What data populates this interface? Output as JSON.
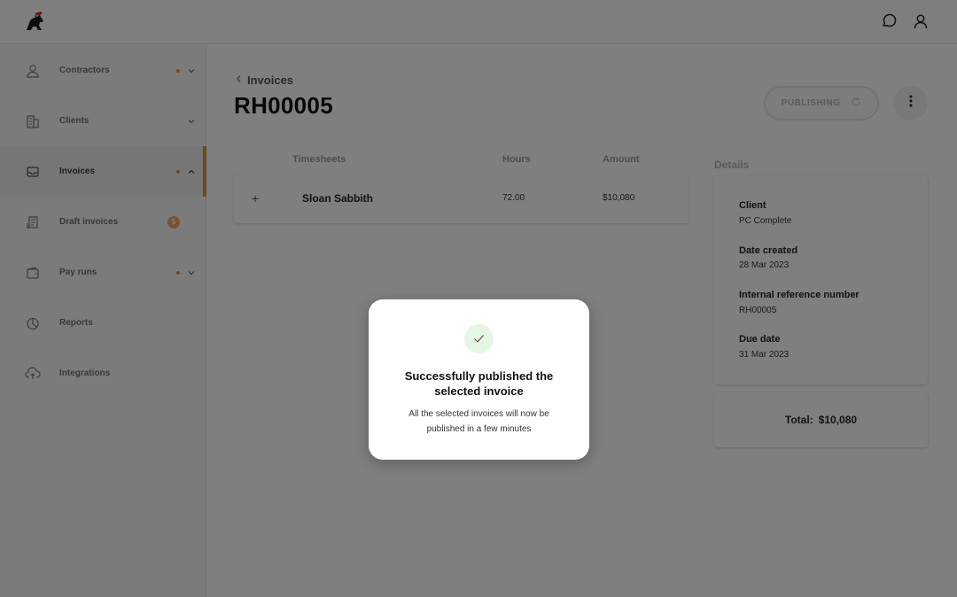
{
  "app": {
    "logo_icon": "mascot-logo"
  },
  "topbar": {
    "icons": [
      "chat-icon",
      "user-icon"
    ]
  },
  "sidebar": {
    "accent_color": "#f08c2e",
    "items": [
      {
        "label": "Contractors",
        "icon": "user-icon",
        "dot": true,
        "chevron": "down"
      },
      {
        "label": "Clients",
        "icon": "building-icon",
        "dot": false,
        "chevron": "down"
      },
      {
        "label": "Invoices",
        "icon": "inbox-icon",
        "dot": true,
        "chevron": "up",
        "active": true
      },
      {
        "label": "Draft invoices",
        "icon": "receipt-icon",
        "badge": "5"
      },
      {
        "label": "Pay runs",
        "icon": "wallet-icon",
        "dot": true,
        "chevron": "down"
      },
      {
        "label": "Reports",
        "icon": "pie-chart-icon"
      },
      {
        "label": "Integrations",
        "icon": "cloud-upload-icon"
      }
    ]
  },
  "breadcrumb": {
    "label": "Invoices"
  },
  "page": {
    "title": "RH00005"
  },
  "actions": {
    "publish_label": "PUBLISHING"
  },
  "timesheets": {
    "headers": {
      "timesheets": "Timesheets",
      "hours": "Hours",
      "amount": "Amount"
    },
    "rows": [
      {
        "expand": "+",
        "name": "Sloan Sabbith",
        "hours": "72.00",
        "amount": "$10,080"
      }
    ]
  },
  "details": {
    "title": "Details",
    "client_label": "Client",
    "client_value": "PC Complete",
    "date_created_label": "Date created",
    "date_created_value": "28 Mar 2023",
    "reference_label": "Internal reference number",
    "reference_value": "RH00005",
    "due_date_label": "Due date",
    "due_date_value": "31 Mar 2023",
    "total_label": "Total:",
    "total_value": "$10,080"
  },
  "modal": {
    "title": "Successfully published the selected invoice",
    "message": "All the selected invoices will now be published in a few minutes",
    "success_color": "#e4f7e4"
  }
}
